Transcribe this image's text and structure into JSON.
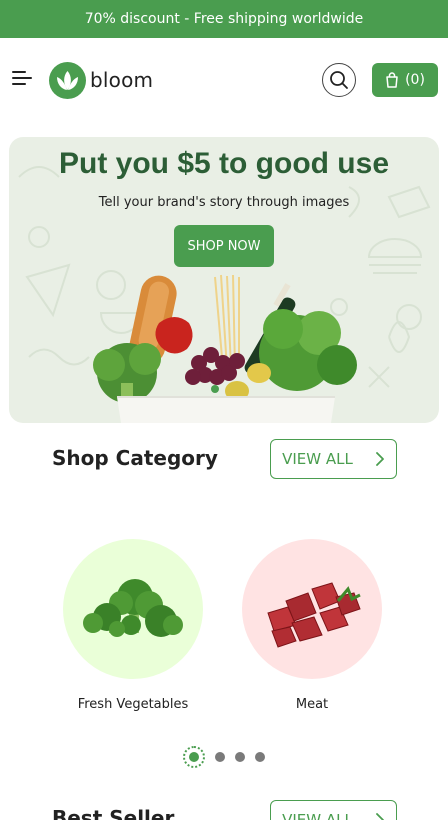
{
  "promo": {
    "text": "70% discount - Free shipping worldwide"
  },
  "header": {
    "logo_text": "bloom",
    "cart_count": "(0)"
  },
  "hero": {
    "title": "Put you $5 to good use",
    "subtitle": "Tell your brand's story through images",
    "cta": "SHOP NOW"
  },
  "category_section": {
    "title": "Shop Category",
    "view_all": "VIEW ALL",
    "items": [
      {
        "label": "Fresh Vegetables",
        "bg": "#eaffd8"
      },
      {
        "label": "Meat",
        "bg": "#ffe3e3"
      }
    ],
    "pagination": {
      "pages": 4,
      "active": 1
    }
  },
  "best_seller_section": {
    "title": "Best Seller",
    "view_all": "VIEW ALL"
  },
  "colors": {
    "brand": "#4a9d4f",
    "hero_title": "#2c5e36",
    "hero_bg": "#e9efe5"
  },
  "icons": [
    "menu-icon",
    "logo-lotus-icon",
    "search-icon",
    "cart-bag-icon",
    "chevron-right-icon"
  ]
}
